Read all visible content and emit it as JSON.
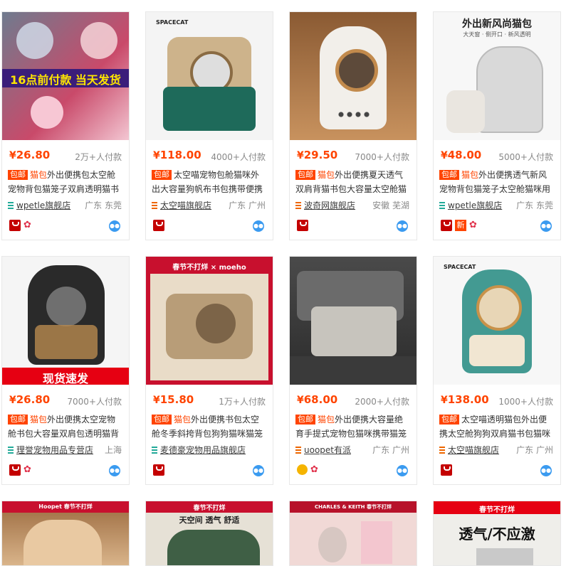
{
  "badge_label": "包邮",
  "products": [
    {
      "price": "26.80",
      "sales": "2万+人付款",
      "hl": "猫包",
      "title": "外出便携包太空舱宠物背包猫笼子双肩透明猫书",
      "shop": "wpetle旗舰店",
      "loc": "广东 东莞",
      "img_text": "16点前付款 当天发货"
    },
    {
      "price": "118.00",
      "sales": "4000+人付款",
      "hl": "",
      "title": "太空喵宠物包舱猫咪外出大容量狗帆布书包携带便携",
      "shop": "太空喵旗舰店",
      "loc": "广东 广州",
      "img_text": "SPACECAT"
    },
    {
      "price": "29.50",
      "sales": "7000+人付款",
      "hl": "猫包",
      "title": "外出便携夏天透气双肩背猫书包大容量太空舱猫",
      "shop": "波奇网旗舰店",
      "loc": "安徽 芜湖",
      "img_text": ""
    },
    {
      "price": "48.00",
      "sales": "5000+人付款",
      "hl": "猫包",
      "title": "外出便携透气新风宠物背包猫笼子太空舱猫咪用",
      "shop": "wpetle旗舰店",
      "loc": "广东 东莞",
      "img_text": "外出新风尚猫包",
      "img_sub": "大天窗 · 侧开口 · 新风透明"
    },
    {
      "price": "26.80",
      "sales": "7000+人付款",
      "hl": "猫包",
      "title": "外出便携太空宠物舱书包大容量双肩包透明猫背",
      "shop": "理誉宠物用品专营店",
      "loc": "上海",
      "img_text": "现货速发"
    },
    {
      "price": "15.80",
      "sales": "1万+人付款",
      "hl": "猫包",
      "title": "外出便携书包太空舱冬季斜挎背包狗狗猫咪猫笼",
      "shop": "麦德豪宠物用品旗舰店",
      "loc": "",
      "img_text": "春节不打烊 × moeho"
    },
    {
      "price": "68.00",
      "sales": "2000+人付款",
      "hl": "猫包",
      "title": "外出便携大容量绝育手提式宠物包猫咪携带猫笼",
      "shop": "uoopet有派",
      "loc": "广东 广州",
      "img_text": ""
    },
    {
      "price": "138.00",
      "sales": "1000+人付款",
      "hl": "",
      "title": "太空喵透明猫包外出便携太空舱狗狗双肩猫书包猫咪",
      "shop": "太空喵旗舰店",
      "loc": "广东 广州",
      "img_text": "SPACECAT"
    }
  ],
  "bottom_row": [
    {
      "text": "Hoopet 春节不打烊"
    },
    {
      "text": "春节不打烊",
      "sub": "天空间 透气 舒适"
    },
    {
      "text": "CHARLES & KEITH 春节不打烊"
    },
    {
      "text": "春节不打烊",
      "sub": "透气/不应激"
    }
  ],
  "colors": {
    "accent": "#ff4400",
    "border": "#e8e8e8"
  }
}
